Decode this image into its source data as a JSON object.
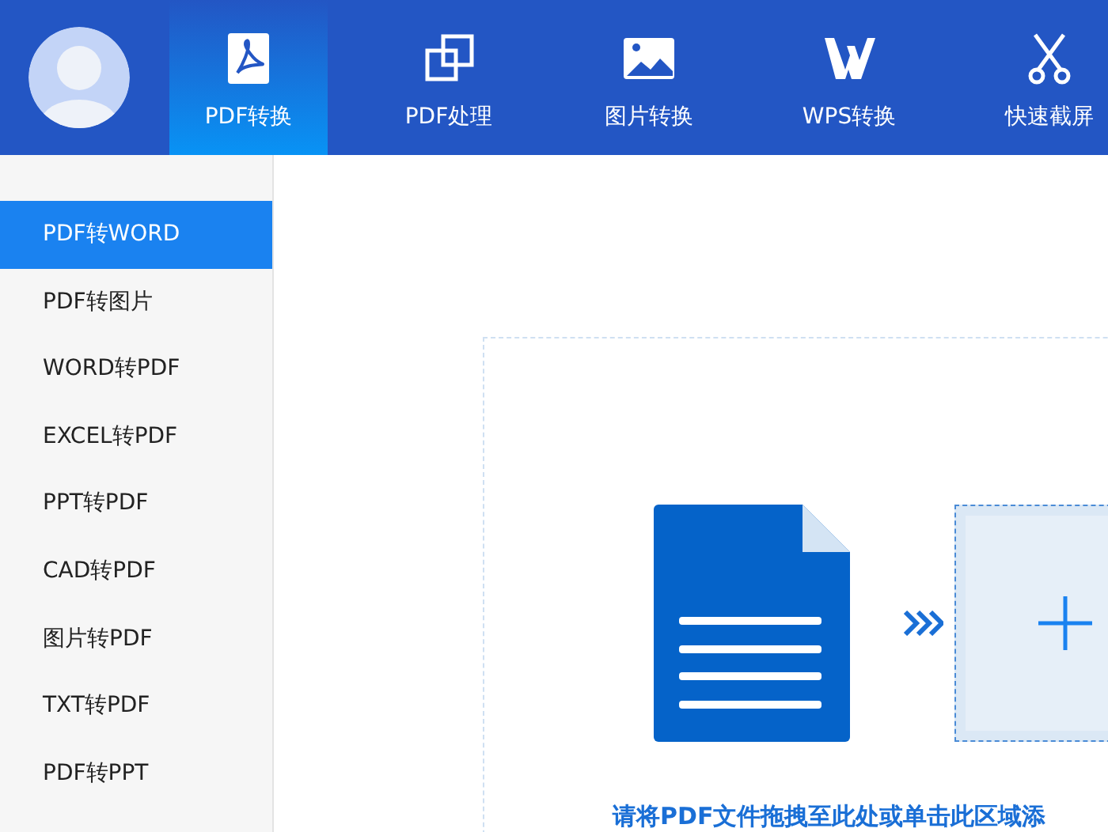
{
  "header": {
    "tabs": [
      {
        "label": "PDF转换",
        "selected": true
      },
      {
        "label": "PDF处理",
        "selected": false
      },
      {
        "label": "图片转换",
        "selected": false
      },
      {
        "label": "WPS转换",
        "selected": false
      },
      {
        "label": "快速截屏",
        "selected": false
      }
    ]
  },
  "sidebar": {
    "items": [
      {
        "label": "PDF转WORD",
        "selected": true
      },
      {
        "label": "PDF转图片",
        "selected": false
      },
      {
        "label": "WORD转PDF",
        "selected": false
      },
      {
        "label": "EXCEL转PDF",
        "selected": false
      },
      {
        "label": "PPT转PDF",
        "selected": false
      },
      {
        "label": "CAD转PDF",
        "selected": false
      },
      {
        "label": "图片转PDF",
        "selected": false
      },
      {
        "label": "TXT转PDF",
        "selected": false
      },
      {
        "label": "PDF转PPT",
        "selected": false
      }
    ]
  },
  "drop_zone": {
    "hint": "请将PDF文件拖拽至此处或单击此区域添"
  }
}
